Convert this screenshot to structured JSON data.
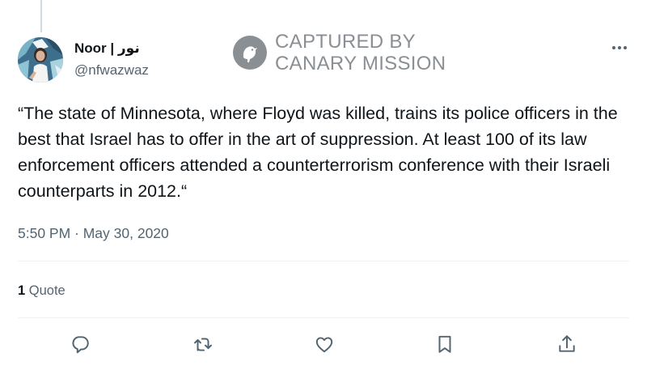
{
  "tweet": {
    "author": {
      "display_name": "Noor | نور",
      "handle": "@nfwazwaz"
    },
    "text": "“The state of Minnesota, where Floyd was killed, trains its police officers in the best that Israel has to offer in the art of suppression. At least 100 of its law enforcement officers attended a counterterrorism conference with their Israeli counterparts in 2012.“",
    "timestamp": "5:50 PM · May 30, 2020",
    "stats": {
      "quote_count": "1",
      "quote_label": "Quote"
    }
  },
  "watermark": {
    "line1": "CAPTURED BY",
    "line2": "CANARY MISSION"
  },
  "icons": {
    "more": "more-horizontal-icon",
    "reply": "reply-icon",
    "retweet": "retweet-icon",
    "like": "like-icon",
    "bookmark": "bookmark-icon",
    "share": "share-icon"
  },
  "colors": {
    "text_primary": "#0f1419",
    "text_secondary": "#536471",
    "divider": "#eff3f4",
    "watermark": "#8a8f94"
  }
}
